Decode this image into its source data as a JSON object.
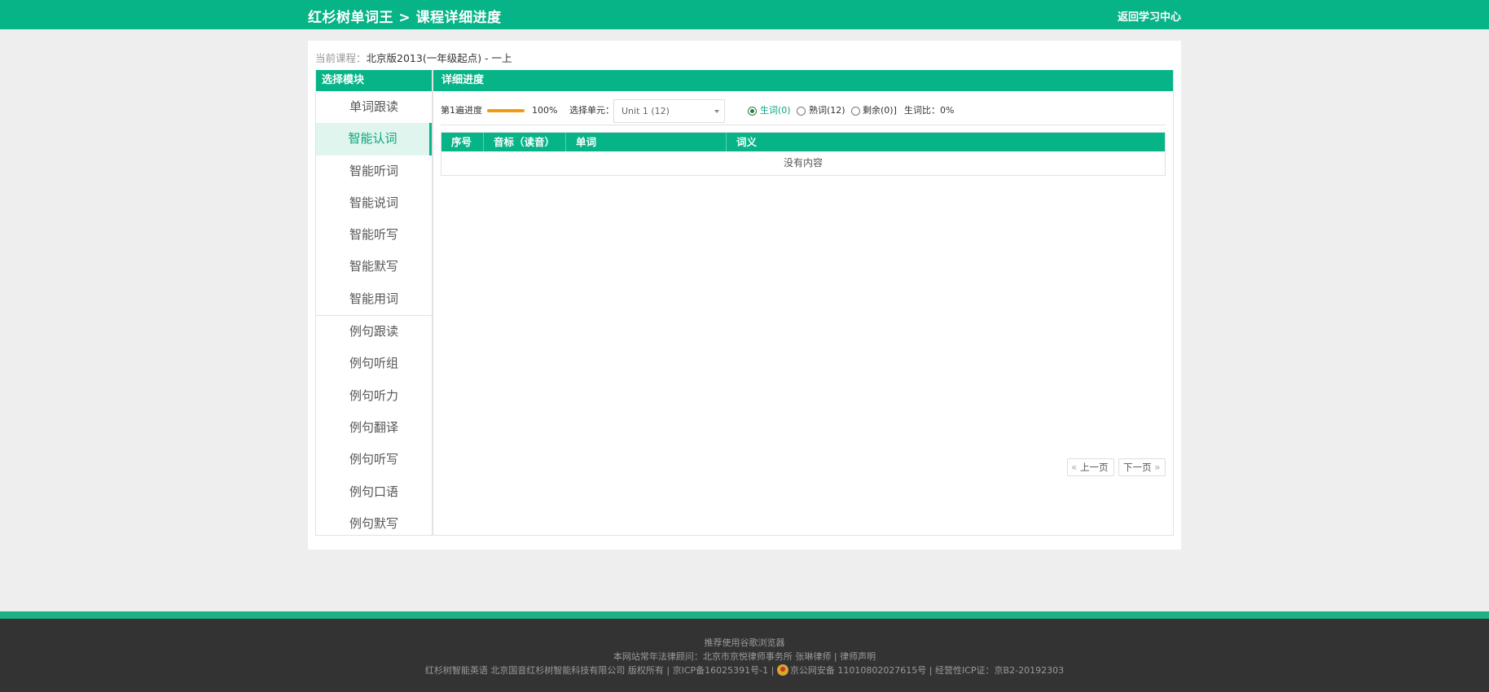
{
  "header": {
    "brand": "红杉树单词王 > 课程详细进度",
    "back_label": "返回学习中心"
  },
  "course": {
    "label": "当前课程：",
    "value": "北京版2013(一年级起点) - 一上"
  },
  "sidebar": {
    "title": "选择模块",
    "groups": [
      {
        "items": [
          "单词跟读",
          "智能认词",
          "智能听词",
          "智能说词",
          "智能听写",
          "智能默写",
          "智能用词"
        ]
      },
      {
        "items": [
          "例句跟读",
          "例句听组",
          "例句听力",
          "例句翻译",
          "例句听写",
          "例句口语",
          "例句默写"
        ]
      }
    ],
    "active": "智能认词"
  },
  "main": {
    "title": "详细进度",
    "progress": {
      "label": "第1遍进度",
      "percent_text": "100%",
      "value": 1.0
    },
    "unit": {
      "label": "选择单元：",
      "selected": "Unit 1 (12)"
    },
    "filters": [
      {
        "label": "生词(0)",
        "checked": true
      },
      {
        "label": "熟词(12)",
        "checked": false
      },
      {
        "label": "剩余(0)]",
        "checked": false
      }
    ],
    "ratio_text": "生词比：0%",
    "table": {
      "columns": [
        "序号",
        "音标（读音）",
        "单词",
        "词义"
      ],
      "empty_text": "没有内容"
    },
    "pager": {
      "prev_label": "上一页",
      "next_label": "下一页"
    }
  },
  "footer": {
    "line1": "推荐使用谷歌浏览器",
    "line2": "本网站常年法律顾问：北京市京悦律师事务所 张琳律师 | 律师声明",
    "line3_a": "红杉树智能英语 北京国音红杉树智能科技有限公司 版权所有 | 京ICP备16025391号-1 |",
    "line3_b": "京公网安备 11010802027615号  | 经营性ICP证：京B2-20192303"
  },
  "colors": {
    "brand_green": "#07b487",
    "progress_orange": "#f39c12",
    "footer_bg": "#333333"
  }
}
